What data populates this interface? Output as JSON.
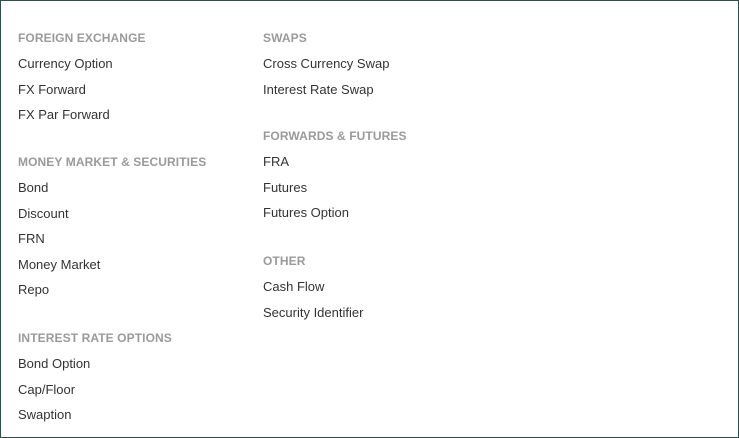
{
  "left_column": {
    "foreign_exchange": {
      "title": "FOREIGN EXCHANGE",
      "items": [
        "Currency Option",
        "FX Forward",
        "FX Par Forward"
      ]
    },
    "money_market": {
      "title": "MONEY MARKET & SECURITIES",
      "items": [
        "Bond",
        "Discount",
        "FRN",
        "Money Market",
        "Repo"
      ]
    },
    "interest_rate_options": {
      "title": "INTEREST RATE OPTIONS",
      "items": [
        "Bond Option",
        "Cap/Floor",
        "Swaption"
      ]
    }
  },
  "right_column": {
    "swaps": {
      "title": "SWAPS",
      "items": [
        "Cross Currency Swap",
        "Interest Rate Swap"
      ]
    },
    "forwards_futures": {
      "title": "FORWARDS & FUTURES",
      "items": [
        "FRA",
        "Futures",
        "Futures Option"
      ]
    },
    "other": {
      "title": "OTHER",
      "items": [
        "Cash Flow",
        "Security Identifier"
      ]
    }
  },
  "colors": {
    "section_title": "#9a9a9a",
    "item_text": "#333333",
    "border": "#2f4f4a",
    "background": "#ffffff"
  }
}
